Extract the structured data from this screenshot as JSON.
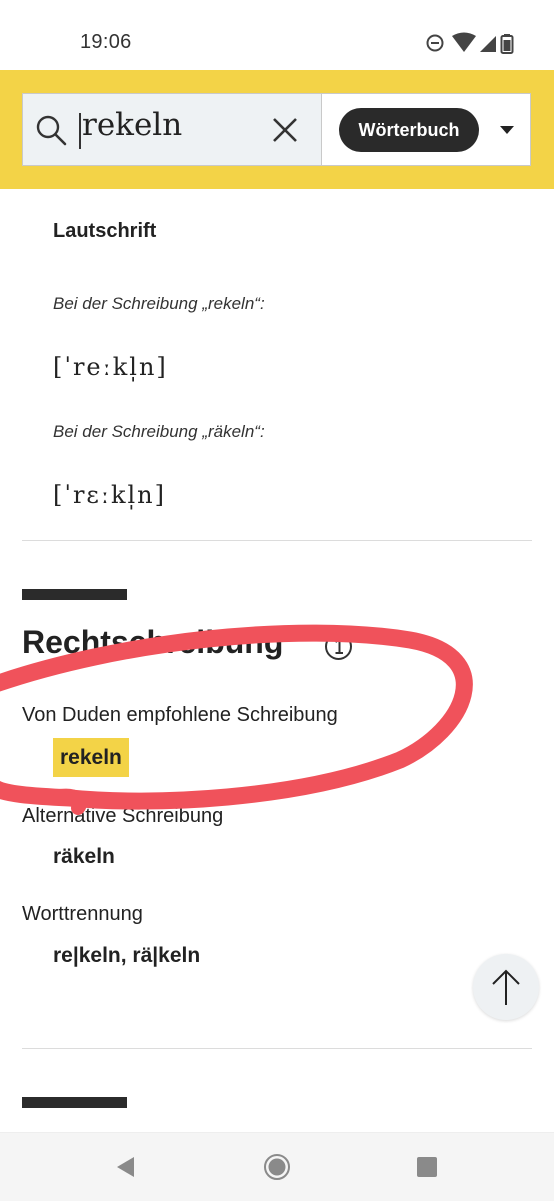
{
  "status_bar": {
    "time": "19:06",
    "icons": [
      "do-not-disturb-icon",
      "wifi-icon",
      "signal-icon",
      "battery-icon"
    ]
  },
  "search": {
    "value": "rekeln",
    "icons": [
      "search-icon",
      "clear-icon"
    ]
  },
  "dictionary_select": {
    "selected": "Wörterbuch",
    "icon": "dropdown-icon"
  },
  "pronunciation": {
    "heading": "Lautschrift",
    "variants": [
      {
        "note": "Bei der Schreibung „rekeln“:",
        "ipa": "[ˈreːkl̩n]"
      },
      {
        "note": "Bei der Schreibung „räkeln“:",
        "ipa": "[ˈrɛːkl̩n]"
      }
    ]
  },
  "spelling": {
    "heading": "Rechtschreibung",
    "info_icon": "info-icon",
    "recommended_label": "Von Duden empfohlene Schreibung",
    "recommended_value": "rekeln",
    "alternative_label": "Alternative Schreibung",
    "alternative_value": "räkeln",
    "hyphenation_label": "Worttrennung",
    "hyphenation_value": "re|keln, rä|keln"
  },
  "scroll_top_icon": "arrow-up-icon",
  "navigation_bar": [
    "back-icon",
    "home-icon",
    "recents-icon"
  ],
  "colors": {
    "brand_yellow": "#f3d347",
    "pill_dark": "#2a2a2a",
    "annotation_red": "#f0525b"
  }
}
